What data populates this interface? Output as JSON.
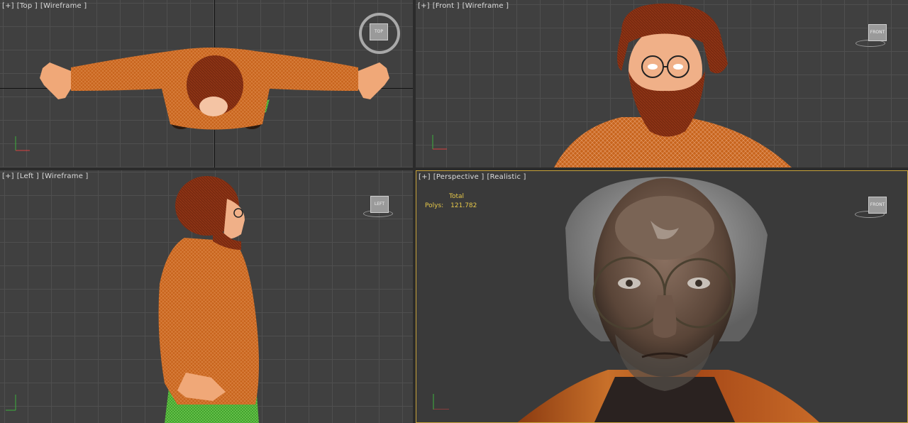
{
  "viewports": {
    "top": {
      "labels": [
        "[+]",
        "[Top ]",
        "[Wireframe ]"
      ],
      "cube_label": "TOP"
    },
    "front": {
      "labels": [
        "[+]",
        "[Front ]",
        "[Wireframe ]"
      ],
      "cube_label": "FRONT"
    },
    "left": {
      "labels": [
        "[+]",
        "[Left ]",
        "[Wireframe ]"
      ],
      "cube_label": "LEFT"
    },
    "perspective": {
      "labels": [
        "[+]",
        "[Perspective ]",
        "[Realistic ]"
      ],
      "cube_label": "FRONT"
    }
  },
  "stats": {
    "header": "Total",
    "polys_label": "Polys:",
    "polys_value": "121.782"
  },
  "colors": {
    "active_border": "#c9a43a",
    "wire_orange": "#c8651e",
    "hair": "#7a2a10",
    "skin": "#f0b088",
    "stats_text": "#e6c84a"
  }
}
